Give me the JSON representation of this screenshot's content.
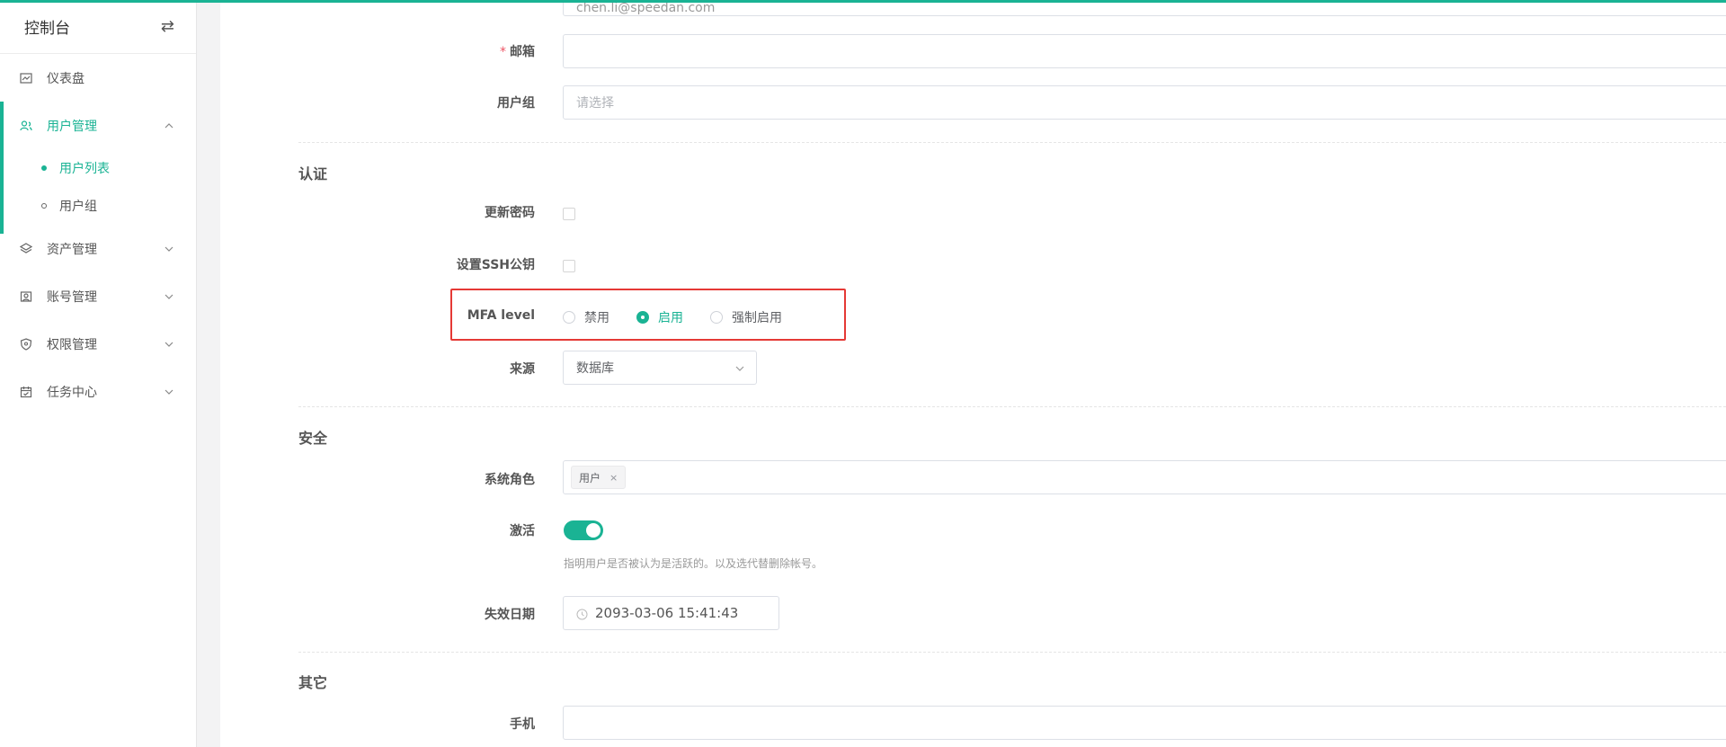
{
  "sidebar": {
    "title": "控制台",
    "toggle_icon": "swap-icon",
    "items": [
      {
        "label": "仪表盘",
        "icon": "dashboard-icon"
      },
      {
        "label": "用户管理",
        "icon": "users-icon",
        "expanded": true,
        "children": [
          {
            "label": "用户列表",
            "active": true
          },
          {
            "label": "用户组",
            "active": false
          }
        ]
      },
      {
        "label": "资产管理",
        "icon": "layers-icon"
      },
      {
        "label": "账号管理",
        "icon": "account-icon"
      },
      {
        "label": "权限管理",
        "icon": "shield-icon"
      },
      {
        "label": "任务中心",
        "icon": "calendar-icon"
      }
    ]
  },
  "form": {
    "email_partial": "chen.li@speedan.com",
    "mail": {
      "label": "邮箱",
      "required_mark": "*",
      "value": ""
    },
    "usergroup": {
      "label": "用户组",
      "placeholder": "请选择"
    },
    "auth_section": "认证",
    "update_password": {
      "label": "更新密码"
    },
    "set_ssh": {
      "label": "设置SSH公钥"
    },
    "mfa": {
      "label": "MFA level",
      "options": [
        "禁用",
        "启用",
        "强制启用"
      ],
      "selected": "启用"
    },
    "source": {
      "label": "来源",
      "value": "数据库"
    },
    "security_section": "安全",
    "system_role": {
      "label": "系统角色",
      "tag": "用户",
      "tag_close": "×"
    },
    "active": {
      "label": "激活",
      "on": true,
      "help": "指明用户是否被认为是活跃的。以及选代替删除帐号。"
    },
    "expire": {
      "label": "失效日期",
      "value": "2093-03-06 15:41:43"
    },
    "other_section": "其它",
    "phone": {
      "label": "手机",
      "value": ""
    }
  },
  "colors": {
    "accent": "#1ab394",
    "highlight": "#e53935"
  }
}
